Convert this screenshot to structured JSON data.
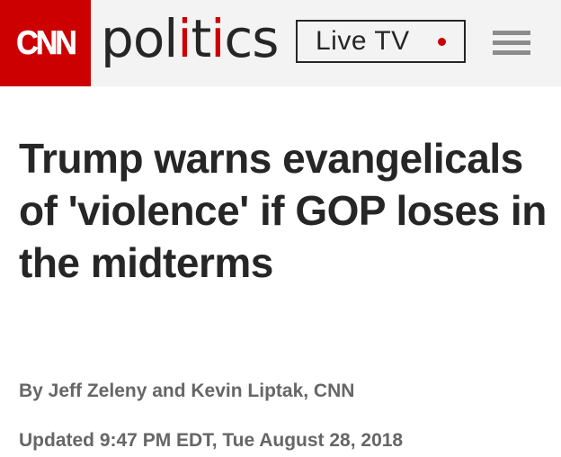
{
  "header": {
    "logo_text": "CNN",
    "section_before": "pol",
    "section_accent": "i",
    "section_middle": "t",
    "section_accent2": "i",
    "section_after": "cs",
    "live_label": "Live TV",
    "live_indicator_color": "#cc0000",
    "menu_icon": "hamburger-menu-icon"
  },
  "colors": {
    "brand_red": "#cc0000",
    "header_bg": "#f3f3f3",
    "text_dark": "#262626",
    "text_meta": "#666666"
  },
  "article": {
    "headline": "Trump warns evangelicals of 'violence' if GOP loses in the midterms",
    "byline": "By Jeff Zeleny and Kevin Liptak, CNN",
    "updated": "Updated 9:47 PM EDT, Tue August 28, 2018"
  }
}
